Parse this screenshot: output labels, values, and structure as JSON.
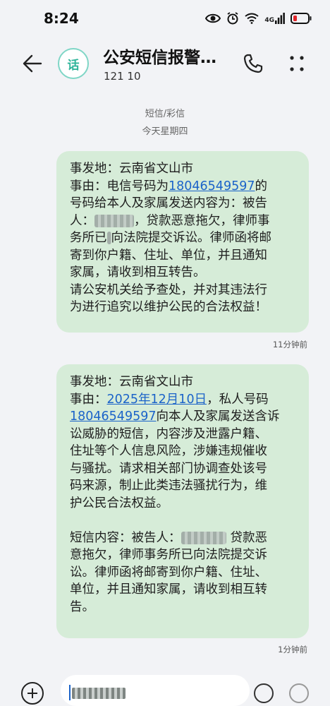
{
  "status_bar": {
    "time": "8:24",
    "network": "4G"
  },
  "header": {
    "avatar_text": "话",
    "title": "公安短信报警…",
    "number": "121 10"
  },
  "date_separator": {
    "type": "短信/彩信",
    "day": "今天星期四"
  },
  "messages": [
    {
      "loc": "事发地：云南省文山市",
      "cause_prefix": "事由：电信号码为",
      "phone": "18046549597",
      "cause_suffix": "的",
      "l3": "号码给本人及家属发送内容为：被告",
      "l4a": "人：",
      "l4b": "，贷款恶意拖欠，律师事",
      "l5a": "务所已",
      "l5b": "向法院提交诉讼。律师函将邮",
      "l6": "寄到你户籍、住址、单位，并且通知",
      "l7": "家属，请收到相互转告。",
      "l8": "请公安机关给予查处，并对其违法行",
      "l9": "为进行追究以维护公民的合法权益！",
      "time": "11分钟前"
    },
    {
      "loc": "事发地：云南省文山市",
      "cause_prefix": "事由：",
      "date": "2025年12月10日",
      "cause_mid": "，私人号码",
      "phone": "18046549597",
      "l3": "向本人及家属发送含诉",
      "l4": "讼威胁的短信，内容涉及泄露户籍、",
      "l5": "住址等个人信息风险，涉嫌违规催收",
      "l6": "与骚扰。请求相关部门协调查处该号",
      "l7": "码来源，制止此类违法骚扰行为，维",
      "l8": "护公民合法权益。",
      "c1a": "短信内容：被告人：",
      "c1b": "贷款恶",
      "c2": "意拖欠，律师事务所已向法院提交诉",
      "c3": "讼。律师函将邮寄到你户籍、住址、",
      "c4": "单位，并且通知家属，请收到相互转",
      "c5": "告。",
      "time": "1分钟前"
    }
  ]
}
